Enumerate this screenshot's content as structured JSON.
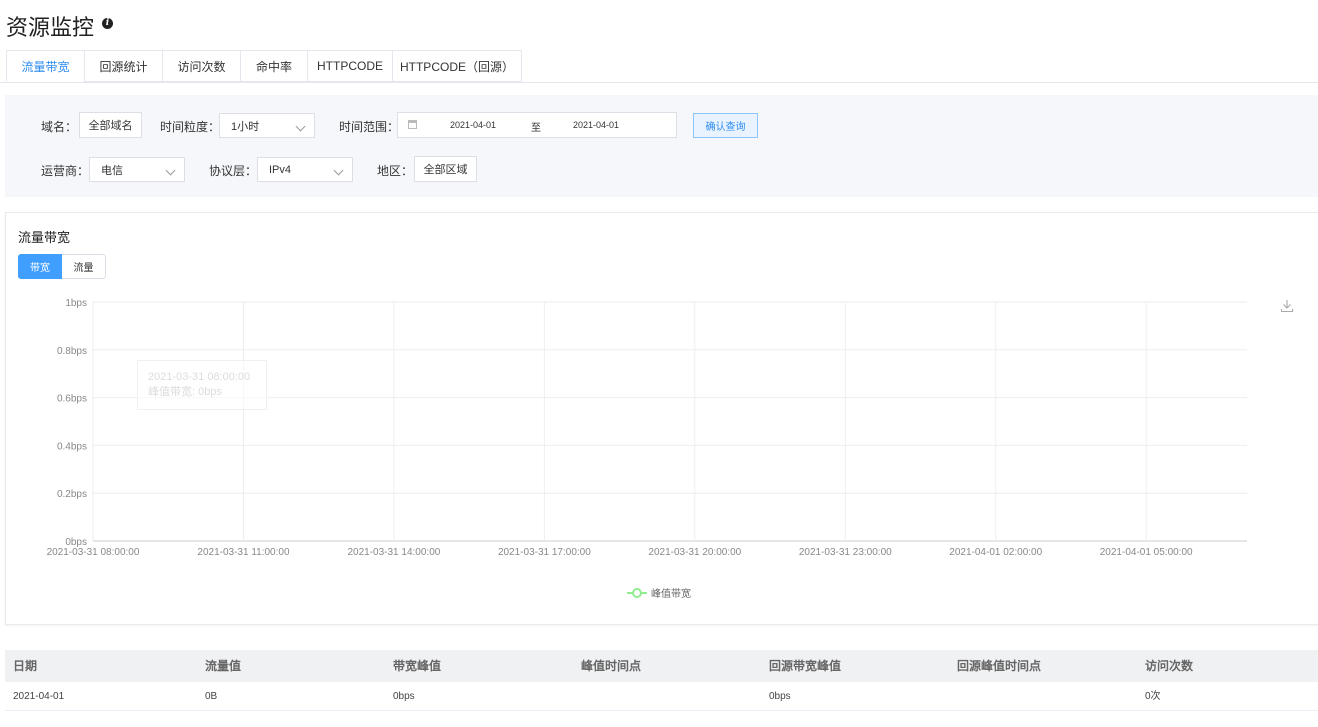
{
  "header": {
    "title": "资源监控",
    "info_icon": "i"
  },
  "tabs": [
    {
      "label": "流量带宽",
      "active": true
    },
    {
      "label": "回源统计",
      "active": false
    },
    {
      "label": "访问次数",
      "active": false
    },
    {
      "label": "命中率",
      "active": false
    },
    {
      "label": "HTTPCODE",
      "active": false
    },
    {
      "label": "HTTPCODE（回源）",
      "active": false
    }
  ],
  "filters": {
    "domain_label": "域名：",
    "domain_button": "全部域名",
    "granularity_label": "时间粒度：",
    "granularity_value": "1小时",
    "range_label": "时间范围：",
    "range_start": "2021-04-01",
    "range_sep": "至",
    "range_end": "2021-04-01",
    "confirm_button": "确认查询",
    "isp_label": "运营商：",
    "isp_value": "电信",
    "protocol_label": "协议层：",
    "protocol_value": "IPv4",
    "region_label": "地区：",
    "region_button": "全部区域"
  },
  "panel": {
    "title": "流量带宽",
    "toggle_bandwidth": "带宽",
    "toggle_traffic": "流量"
  },
  "tooltip": {
    "time": "2021-03-31 08:00:00",
    "value": "峰值带宽: 0bps"
  },
  "chart_data": {
    "type": "line",
    "x": [
      "2021-03-31 08:00:00",
      "2021-03-31 11:00:00",
      "2021-03-31 14:00:00",
      "2021-03-31 17:00:00",
      "2021-03-31 20:00:00",
      "2021-03-31 23:00:00",
      "2021-04-01 02:00:00",
      "2021-04-01 05:00:00"
    ],
    "y_ticks": [
      "0bps",
      "0.2bps",
      "0.4bps",
      "0.6bps",
      "0.8bps",
      "1bps"
    ],
    "ylim": [
      0,
      1
    ],
    "series": [
      {
        "name": "峰值带宽",
        "values": []
      }
    ],
    "legend_position": "bottom-center",
    "grid": true,
    "colors": {
      "series": "#90ee90",
      "grid": "#eeeeee",
      "axis": "#cccccc"
    }
  },
  "table": {
    "headers": [
      "日期",
      "流量值",
      "带宽峰值",
      "峰值时间点",
      "回源带宽峰值",
      "回源峰值时间点",
      "访问次数"
    ],
    "rows": [
      [
        "2021-04-01",
        "0B",
        "0bps",
        "",
        "0bps",
        "",
        "0次"
      ]
    ]
  },
  "colors": {
    "accent": "#409eff",
    "tab_active": "#2d8cf0",
    "filter_bg": "#f5f7fa"
  }
}
